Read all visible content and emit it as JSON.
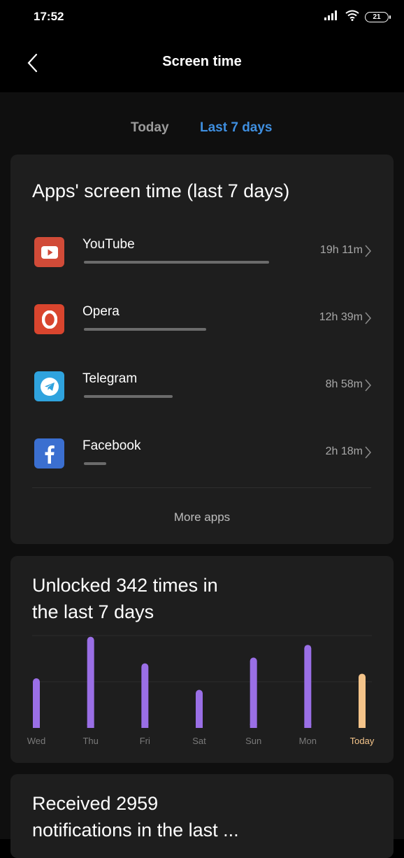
{
  "status": {
    "time": "17:52",
    "battery": "21"
  },
  "header": {
    "title": "Screen time"
  },
  "tabs": [
    {
      "label": "Today",
      "active": false
    },
    {
      "label": "Last 7 days",
      "active": true,
      "color": "#3f8fe0"
    }
  ],
  "apps_card": {
    "title": "Apps' screen time (last 7 days)",
    "apps": [
      {
        "name": "YouTube",
        "time": "19h 11m",
        "usage_fraction": 1.0,
        "icon": "youtube-icon",
        "color": "#d14b38"
      },
      {
        "name": "Opera",
        "time": "12h 39m",
        "usage_fraction": 0.66,
        "icon": "opera-icon",
        "color": "#d9452e"
      },
      {
        "name": "Telegram",
        "time": "8h 58m",
        "usage_fraction": 0.48,
        "icon": "telegram-icon",
        "color": "#2fa3de"
      },
      {
        "name": "Facebook",
        "time": "2h 18m",
        "usage_fraction": 0.12,
        "icon": "facebook-icon",
        "color": "#3b6fd0"
      }
    ],
    "more_label": "More apps"
  },
  "unlock_card": {
    "title_line1": "Unlocked 342 times in",
    "title_line2": "the last 7 days"
  },
  "chart_data": {
    "type": "bar",
    "categories": [
      "Wed",
      "Thu",
      "Fri",
      "Sat",
      "Sun",
      "Mon",
      "Today"
    ],
    "values": [
      43,
      79,
      56,
      33,
      61,
      72,
      47
    ],
    "ylim": [
      0,
      80
    ],
    "bar_color": "#9a6fe6",
    "highlight_color": "#f4c48a",
    "highlight_category": "Today",
    "grid": true
  },
  "notif_card": {
    "title_line1": "Received 2959",
    "title_line2": "notifications in the last ..."
  }
}
